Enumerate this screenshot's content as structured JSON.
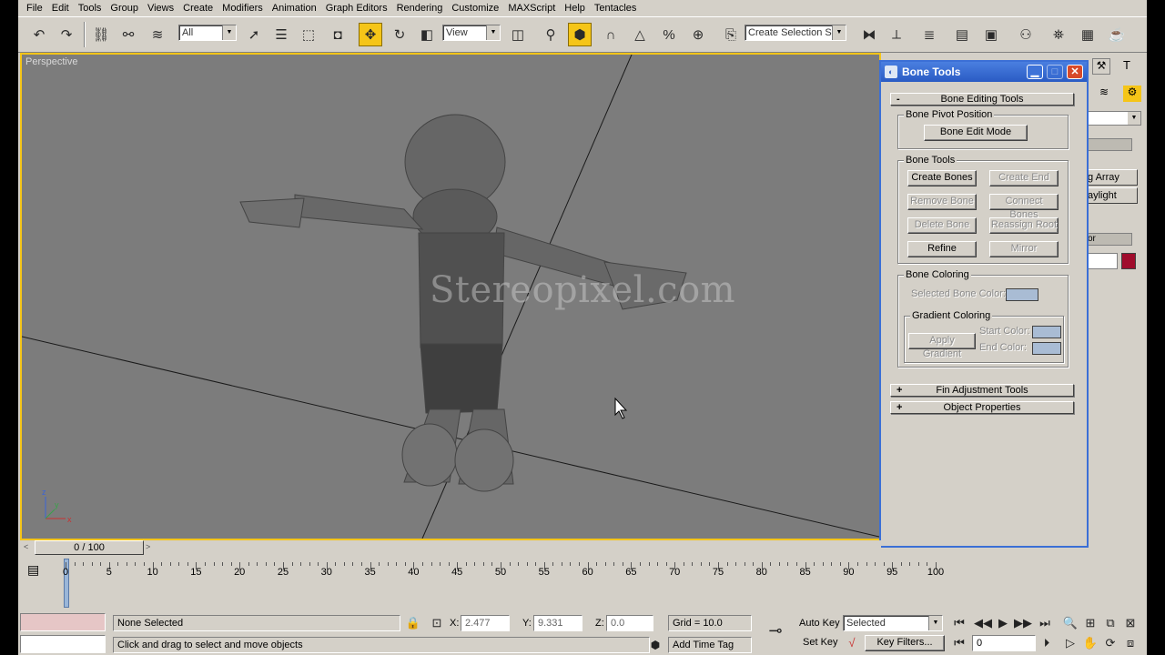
{
  "menu": [
    "File",
    "Edit",
    "Tools",
    "Group",
    "Views",
    "Create",
    "Modifiers",
    "Animation",
    "Graph Editors",
    "Rendering",
    "Customize",
    "MAXScript",
    "Help",
    "Tentacles"
  ],
  "toolbar": {
    "filter_value": "All",
    "ref_coord_value": "View",
    "selection_set_placeholder": "Create Selection Set"
  },
  "viewport": {
    "label": "Perspective",
    "watermark": "Stereopixel.com",
    "axis_labels": {
      "x": "x",
      "y": "y",
      "z": "z"
    }
  },
  "bone_tools": {
    "title": "Bone Tools",
    "editing_rollout": "Bone Editing Tools",
    "rollout_open_sign": "-",
    "pivot_group": "Bone Pivot Position",
    "bone_edit_mode": "Bone Edit Mode",
    "tools_group": "Bone Tools",
    "create_bones": "Create Bones",
    "create_end": "Create End",
    "remove_bone": "Remove Bone",
    "connect_bones": "Connect Bones",
    "delete_bone": "Delete Bone",
    "reassign_root": "Reassign Root",
    "refine": "Refine",
    "mirror": "Mirror",
    "coloring_group": "Bone Coloring",
    "selected_bone_color": "Selected Bone Color:",
    "gradient_group": "Gradient Coloring",
    "apply_gradient": "Apply Gradient",
    "start_color": "Start Color:",
    "end_color": "End Color:",
    "swatch_color": "#a9bcd4",
    "fin_rollout": "Fin Adjustment Tools",
    "object_props_rollout": "Object Properties",
    "rollout_closed_sign": "+"
  },
  "command_panel": {
    "array_label": "g Array",
    "daylight_label": "aylight",
    "color_label": "or",
    "object_color": "#a00c2c"
  },
  "time_slider": {
    "position": "0 / 100",
    "left_arrow": "<",
    "right_arrow": ">"
  },
  "trackbar": {
    "ticks": [
      "0",
      "5",
      "10",
      "15",
      "20",
      "25",
      "30",
      "35",
      "40",
      "45",
      "50",
      "55",
      "60",
      "65",
      "70",
      "75",
      "80",
      "85",
      "90",
      "95",
      "100"
    ]
  },
  "status": {
    "selection": "None Selected",
    "prompt": "Click and drag to select and move objects",
    "x_label": "X:",
    "x_value": "2.477",
    "y_label": "Y:",
    "y_value": "9.331",
    "z_label": "Z:",
    "z_value": "0.0",
    "grid": "Grid = 10.0",
    "add_time_tag": "Add Time Tag",
    "auto_key": "Auto Key",
    "set_key": "Set Key",
    "key_mode_value": "Selected",
    "key_filters": "Key Filters...",
    "frame_value": "0"
  }
}
